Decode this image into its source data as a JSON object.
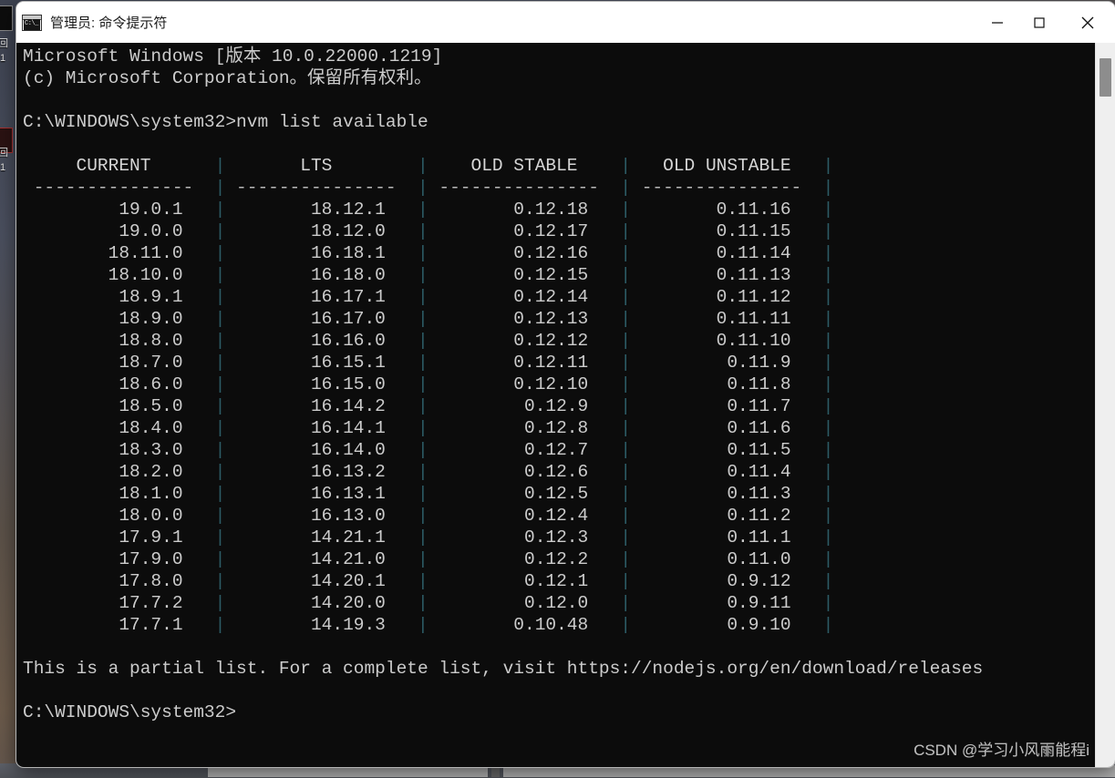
{
  "window": {
    "title": "管理员: 命令提示符",
    "icon": "console-icon",
    "controls": {
      "minimize_label": "—",
      "maximize_label": "□",
      "close_label": "✕"
    }
  },
  "colors": {
    "console_bg": "#0c0c0c",
    "console_fg": "#cccccc",
    "separator": "#2d5c66",
    "titlebar_bg": "#ffffff",
    "scrollbar_track": "#efefef",
    "scrollbar_thumb": "#8d8d8d"
  },
  "console": {
    "banner_line_1": "Microsoft Windows [版本 10.0.22000.1219]",
    "banner_line_2": "(c) Microsoft Corporation。保留所有权利。",
    "prompt_1": "C:\\WINDOWS\\system32>",
    "command_1": "nvm list available",
    "footer_note": "This is a partial list. For a complete list, visit https://nodejs.org/en/download/releases",
    "prompt_2": "C:\\WINDOWS\\system32>",
    "cursor": ""
  },
  "table": {
    "separator_char": "|",
    "rule_char": "-",
    "rule_width": 15,
    "headers": [
      "CURRENT",
      "LTS",
      "OLD STABLE",
      "OLD UNSTABLE"
    ],
    "rows": [
      [
        "19.0.1",
        "18.12.1",
        "0.12.18",
        "0.11.16"
      ],
      [
        "19.0.0",
        "18.12.0",
        "0.12.17",
        "0.11.15"
      ],
      [
        "18.11.0",
        "16.18.1",
        "0.12.16",
        "0.11.14"
      ],
      [
        "18.10.0",
        "16.18.0",
        "0.12.15",
        "0.11.13"
      ],
      [
        "18.9.1",
        "16.17.1",
        "0.12.14",
        "0.11.12"
      ],
      [
        "18.9.0",
        "16.17.0",
        "0.12.13",
        "0.11.11"
      ],
      [
        "18.8.0",
        "16.16.0",
        "0.12.12",
        "0.11.10"
      ],
      [
        "18.7.0",
        "16.15.1",
        "0.12.11",
        "0.11.9"
      ],
      [
        "18.6.0",
        "16.15.0",
        "0.12.10",
        "0.11.8"
      ],
      [
        "18.5.0",
        "16.14.2",
        "0.12.9",
        "0.11.7"
      ],
      [
        "18.4.0",
        "16.14.1",
        "0.12.8",
        "0.11.6"
      ],
      [
        "18.3.0",
        "16.14.0",
        "0.12.7",
        "0.11.5"
      ],
      [
        "18.2.0",
        "16.13.2",
        "0.12.6",
        "0.11.4"
      ],
      [
        "18.1.0",
        "16.13.1",
        "0.12.5",
        "0.11.3"
      ],
      [
        "18.0.0",
        "16.13.0",
        "0.12.4",
        "0.11.2"
      ],
      [
        "17.9.1",
        "14.21.1",
        "0.12.3",
        "0.11.1"
      ],
      [
        "17.9.0",
        "14.21.0",
        "0.12.2",
        "0.11.0"
      ],
      [
        "17.8.0",
        "14.20.1",
        "0.12.1",
        "0.9.12"
      ],
      [
        "17.7.2",
        "14.20.0",
        "0.12.0",
        "0.9.11"
      ],
      [
        "17.7.1",
        "14.19.3",
        "0.10.48",
        "0.9.10"
      ]
    ]
  },
  "scrollbar": {
    "thumb_top_pct": 2
  },
  "watermark": {
    "text_primary": "CSDN @学习小风雨能程i",
    "text_secondary": "CSDN @学习小风丽能程i"
  },
  "desktop": {
    "icons": [
      {
        "label": "回",
        "kind": "folder"
      },
      {
        "label": "回",
        "kind": "recycle"
      }
    ]
  },
  "taskbar": {
    "segments": 3
  }
}
